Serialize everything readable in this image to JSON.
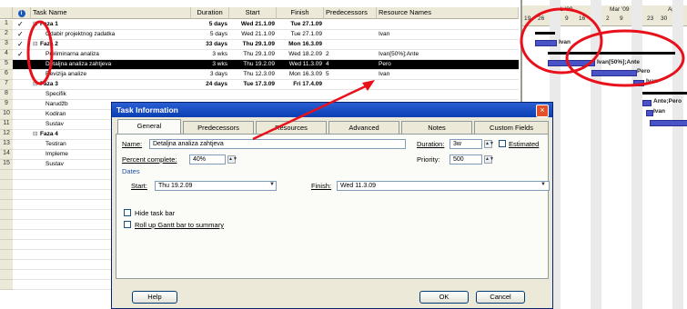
{
  "columns": {
    "info_icon": "i",
    "task_name": "Task Name",
    "duration": "Duration",
    "start": "Start",
    "finish": "Finish",
    "predecessors": "Predecessors",
    "resource_names": "Resource Names"
  },
  "rows": [
    {
      "num": "1",
      "check": true,
      "name": "Faza 1",
      "summary": true,
      "indent": 0,
      "duration": "5 days",
      "start": "Wed 21.1.09",
      "finish": "Tue 27.1.09",
      "pred": "",
      "res": ""
    },
    {
      "num": "2",
      "check": true,
      "name": "Odabir projektnog zadatka",
      "summary": false,
      "indent": 1,
      "duration": "5 days",
      "start": "Wed 21.1.09",
      "finish": "Tue 27.1.09",
      "pred": "",
      "res": "Ivan"
    },
    {
      "num": "3",
      "check": true,
      "name": "Faza 2",
      "summary": true,
      "indent": 0,
      "duration": "33 days",
      "start": "Thu 29.1.09",
      "finish": "Mon 16.3.09",
      "pred": "",
      "res": ""
    },
    {
      "num": "4",
      "check": true,
      "name": "Preliminarna analiza",
      "summary": false,
      "indent": 1,
      "duration": "3 wks",
      "start": "Thu 29.1.09",
      "finish": "Wed 18.2.09",
      "pred": "2",
      "res": "Ivan[50%];Ante"
    },
    {
      "num": "5",
      "check": false,
      "name": "Detaljna analiza zahtjeva",
      "summary": false,
      "indent": 1,
      "duration": "3 wks",
      "start": "Thu 19.2.09",
      "finish": "Wed 11.3.09",
      "pred": "4",
      "res": "Pero",
      "selected": true
    },
    {
      "num": "6",
      "check": false,
      "name": "Revizija analize",
      "summary": false,
      "indent": 1,
      "duration": "3 days",
      "start": "Thu 12.3.09",
      "finish": "Mon 16.3.09",
      "pred": "5",
      "res": "Ivan"
    },
    {
      "num": "7",
      "check": false,
      "name": "Faza 3",
      "summary": true,
      "indent": 0,
      "duration": "24 days",
      "start": "Tue 17.3.09",
      "finish": "Fri 17.4.09",
      "pred": "",
      "res": ""
    },
    {
      "num": "8",
      "check": false,
      "name": "Specifik",
      "summary": false,
      "indent": 1,
      "duration": "",
      "start": "",
      "finish": "",
      "pred": "",
      "res": ""
    },
    {
      "num": "9",
      "check": false,
      "name": "Narudžb",
      "summary": false,
      "indent": 1,
      "duration": "",
      "start": "",
      "finish": "",
      "pred": "",
      "res": ""
    },
    {
      "num": "10",
      "check": false,
      "name": "Kodiran",
      "summary": false,
      "indent": 1,
      "duration": "",
      "start": "",
      "finish": "",
      "pred": "",
      "res": ""
    },
    {
      "num": "11",
      "check": false,
      "name": "Sustav",
      "summary": false,
      "indent": 1,
      "duration": "",
      "start": "",
      "finish": "",
      "pred": "",
      "res": ""
    },
    {
      "num": "12",
      "check": false,
      "name": "Faza 4",
      "summary": true,
      "indent": 0,
      "duration": "",
      "start": "",
      "finish": "",
      "pred": "",
      "res": ""
    },
    {
      "num": "13",
      "check": false,
      "name": "Testiran",
      "summary": false,
      "indent": 1,
      "duration": "",
      "start": "",
      "finish": "",
      "pred": "",
      "res": ""
    },
    {
      "num": "14",
      "check": false,
      "name": "Impleme",
      "summary": false,
      "indent": 1,
      "duration": "",
      "start": "",
      "finish": "",
      "pred": "",
      "res": ""
    },
    {
      "num": "15",
      "check": false,
      "name": "Sustav",
      "summary": false,
      "indent": 1,
      "duration": "",
      "start": "",
      "finish": "",
      "pred": "",
      "res": ""
    }
  ],
  "gantt": {
    "months": [
      "Feb '09",
      "Mar '09",
      "Apr '0"
    ],
    "days": [
      "19",
      "26",
      "2",
      "9",
      "16",
      "23",
      "2",
      "9",
      "16",
      "23",
      "30",
      "6"
    ],
    "labels": {
      "r2": "Ivan",
      "r4": "Ivan[50%];Ante",
      "r5": "Pero",
      "r6": "Ivan",
      "r8": "Ante;Pero",
      "r9": "Ivan"
    }
  },
  "dialog": {
    "title": "Task Information",
    "close": "×",
    "tabs": [
      "General",
      "Predecessors",
      "Resources",
      "Advanced",
      "Notes",
      "Custom Fields"
    ],
    "name_label": "Name:",
    "name_value": "Detaljna analiza zahtjeva",
    "duration_label": "Duration:",
    "duration_value": "3w",
    "estimated_label": "Estimated",
    "percent_label": "Percent complete:",
    "percent_value": "40%",
    "priority_label": "Priority:",
    "priority_value": "500",
    "dates_label": "Dates",
    "start_label": "Start:",
    "start_value": "Thu 19.2.09",
    "finish_label": "Finish:",
    "finish_value": "Wed 11.3.09",
    "hide_task_bar": "Hide task bar",
    "rollup_label": "Roll up Gantt bar to summary",
    "help": "Help",
    "ok": "OK",
    "cancel": "Cancel"
  },
  "colors": {
    "annotation": "#e8101a",
    "bar": "#4a52c8",
    "titlebar": "#0a3fb4"
  }
}
